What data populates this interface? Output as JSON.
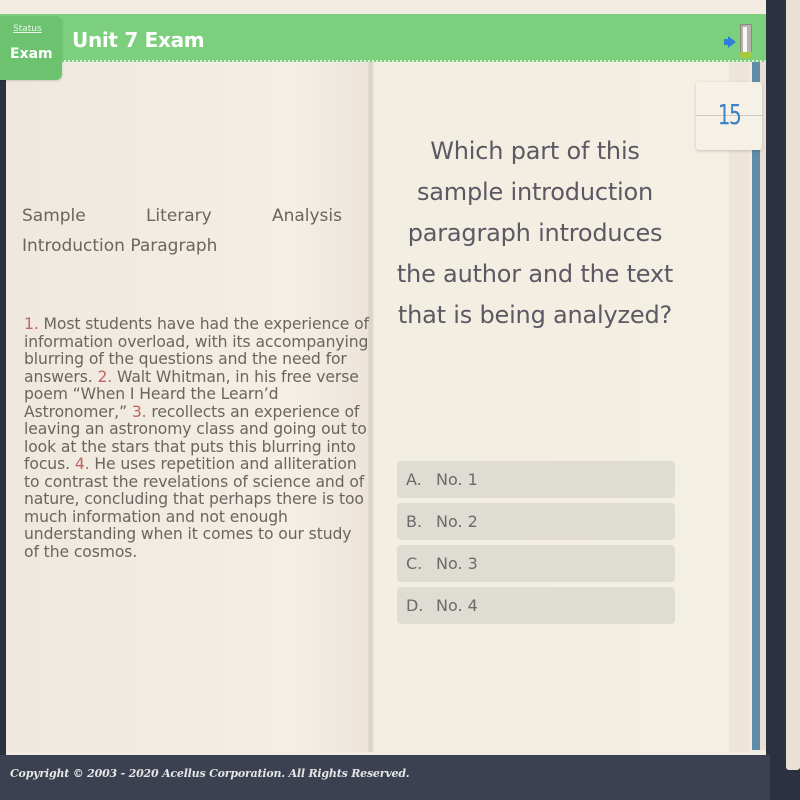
{
  "header": {
    "title": "Unit 7 Exam",
    "status_label": "Status",
    "status_value": "Exam",
    "exit_icon": "exit-door-icon"
  },
  "question_number": "15",
  "passage": {
    "title_words": [
      "Sample",
      "Literary",
      "Analysis"
    ],
    "title_line2": "Introduction Paragraph",
    "segments": [
      {
        "num": "1.",
        "text": " Most students have had the experience of information overload, with its accompanying blurring of the questions and the need for answers. "
      },
      {
        "num": "2.",
        "text": " Walt Whitman, in his free verse poem “When I Heard the Learn’d Astronomer,” "
      },
      {
        "num": "3.",
        "text": " recollects an experience of leaving an astronomy class and going out to look at the stars that puts this blurring into focus.  "
      },
      {
        "num": "4.",
        "text": " He uses repetition and alliteration to contrast the revelations of science and of nature, concluding that perhaps there is too much information and not enough understanding when it comes to our study of the cosmos."
      }
    ]
  },
  "question": {
    "text": "Which part of this sample introduction paragraph introduces the author and the text that is being analyzed?",
    "choices": [
      {
        "letter": "A.",
        "text": "No. 1"
      },
      {
        "letter": "B.",
        "text": "No. 2"
      },
      {
        "letter": "C.",
        "text": "No. 3"
      },
      {
        "letter": "D.",
        "text": "No. 4"
      }
    ]
  },
  "footer": {
    "copyright": "Copyright © 2003 - 2020 Acellus Corporation.  All Rights Reserved."
  },
  "colors": {
    "header_green": "#7ccf7d",
    "number_red": "#c26561",
    "question_number_blue": "#3f83c4",
    "choice_bg": "#dfdcd3",
    "footer_bg": "#3b4150"
  }
}
